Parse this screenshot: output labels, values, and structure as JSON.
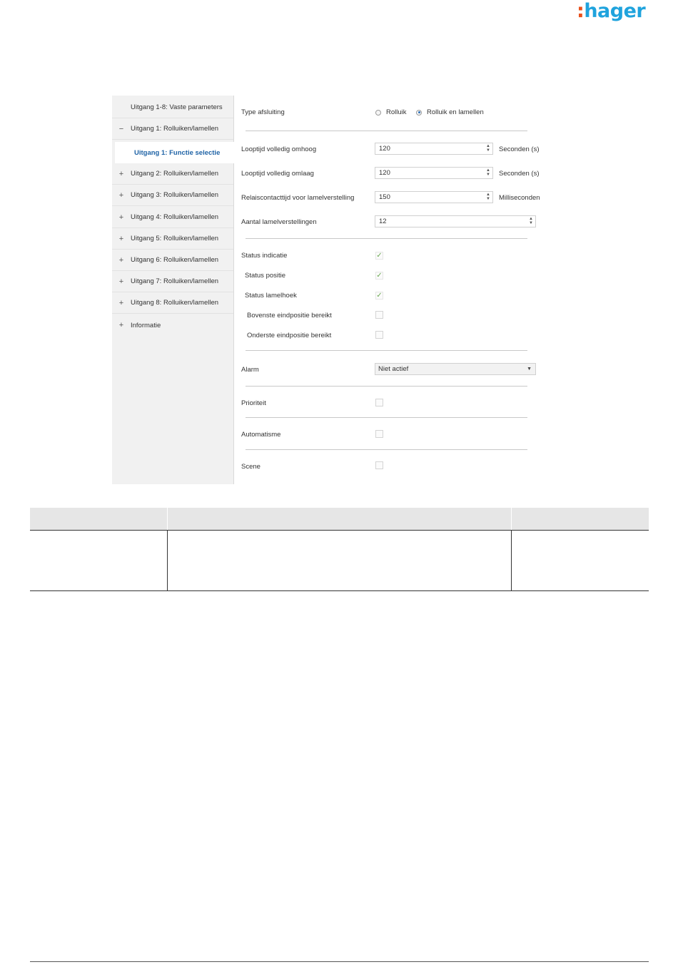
{
  "brand": {
    "colon": ":",
    "name": "hager"
  },
  "sidebar": {
    "items": [
      {
        "symbol": "",
        "label": "Uitgang 1-8: Vaste parameters"
      },
      {
        "symbol": "−",
        "label": "Uitgang 1: Rolluiken/lamellen"
      },
      {
        "symbol": "",
        "label": "Uitgang 1: Functie selectie",
        "active": true
      },
      {
        "symbol": "+",
        "label": "Uitgang 2: Rolluiken/lamellen"
      },
      {
        "symbol": "+",
        "label": "Uitgang 3: Rolluiken/lamellen"
      },
      {
        "symbol": "+",
        "label": "Uitgang 4: Rolluiken/lamellen"
      },
      {
        "symbol": "+",
        "label": "Uitgang 5: Rolluiken/lamellen"
      },
      {
        "symbol": "+",
        "label": "Uitgang 6: Rolluiken/lamellen"
      },
      {
        "symbol": "+",
        "label": "Uitgang 7: Rolluiken/lamellen"
      },
      {
        "symbol": "+",
        "label": "Uitgang 8: Rolluiken/lamellen"
      },
      {
        "symbol": "+",
        "label": "Informatie"
      }
    ]
  },
  "params": {
    "type_afsluiting": {
      "label": "Type afsluiting",
      "options": [
        "Rolluik",
        "Rolluik en lamellen"
      ],
      "selected": "Rolluik en lamellen"
    },
    "looptijd_omhoog": {
      "label": "Looptijd volledig omhoog",
      "value": "120",
      "unit": "Seconden (s)"
    },
    "looptijd_omlaag": {
      "label": "Looptijd volledig omlaag",
      "value": "120",
      "unit": "Seconden (s)"
    },
    "relaiscontacttijd": {
      "label": "Relaiscontacttijd voor lamelverstelling",
      "value": "150",
      "unit": "Milliseconden"
    },
    "aantal_lamel": {
      "label": "Aantal lamelverstellingen",
      "value": "12"
    },
    "status_indicatie": {
      "label": "Status indicatie",
      "checked": true
    },
    "status_positie": {
      "label": "Status positie",
      "checked": true
    },
    "status_lamelhoek": {
      "label": "Status lamelhoek",
      "checked": true
    },
    "bovenste": {
      "label": "Bovenste eindpositie bereikt",
      "checked": false
    },
    "onderste": {
      "label": "Onderste eindpositie bereikt",
      "checked": false
    },
    "alarm": {
      "label": "Alarm",
      "value": "Niet actief"
    },
    "prioriteit": {
      "label": "Prioriteit",
      "checked": false
    },
    "automatisme": {
      "label": "Automatisme",
      "checked": false
    },
    "scene": {
      "label": "Scene",
      "checked": false
    }
  },
  "icons": {
    "check": "checkmark-icon",
    "caret": "dropdown-caret-icon",
    "spinner": "spin-arrows-icon"
  },
  "colors": {
    "brand_blue": "#1fa3dd",
    "brand_orange": "#e8501b",
    "active_nav": "#1f63a6",
    "check_green": "#6aa84f"
  }
}
